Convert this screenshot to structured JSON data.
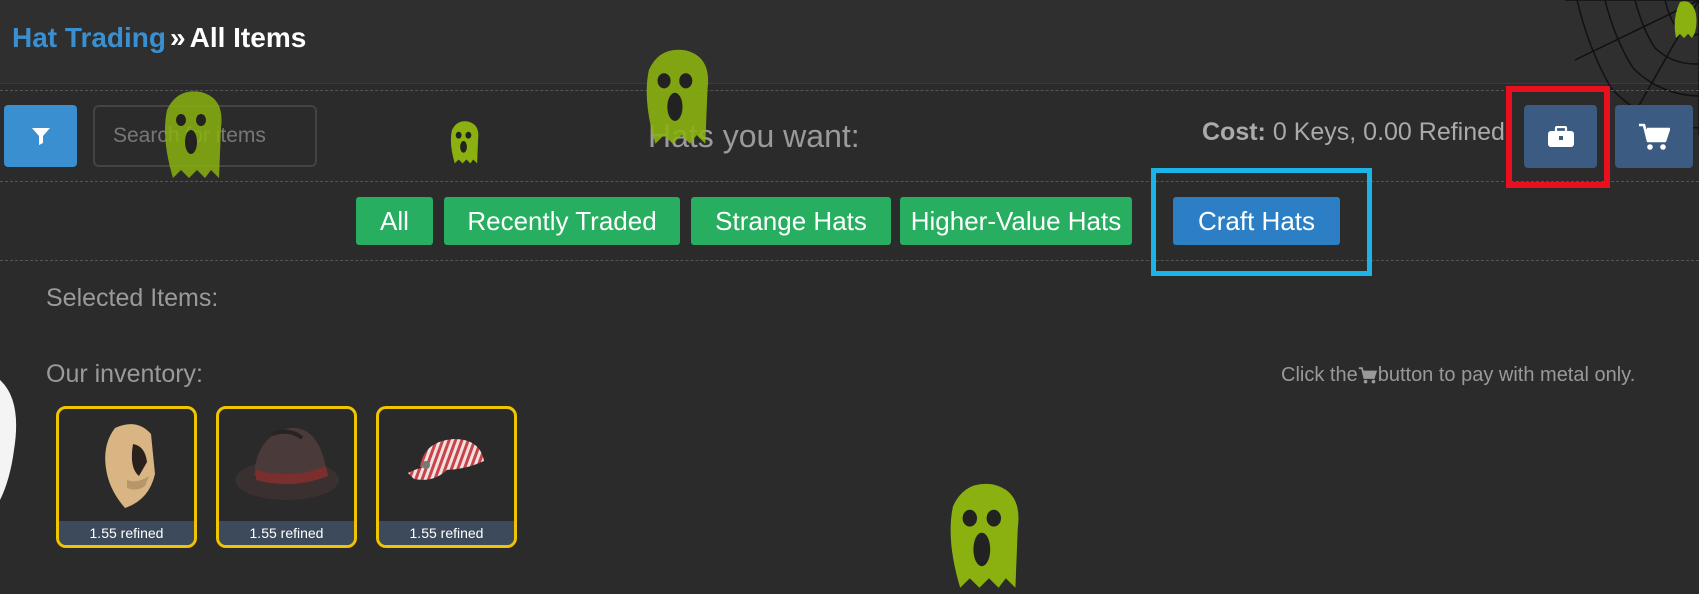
{
  "breadcrumb": {
    "link": "Hat Trading",
    "separator": "»",
    "current": "All Items"
  },
  "search": {
    "placeholder": "Search for items",
    "value": ""
  },
  "hats_title": "Hats you want:",
  "cost": {
    "label": "Cost:",
    "value": "0 Keys, 0.00 Refined"
  },
  "buttons": {
    "filter": "filter-icon",
    "briefcase": "briefcase-icon",
    "cart": "cart-icon"
  },
  "tabs": [
    {
      "label": "All",
      "active": false
    },
    {
      "label": "Recently Traded",
      "active": false
    },
    {
      "label": "Strange Hats",
      "active": false
    },
    {
      "label": "Higher-Value Hats",
      "active": false
    },
    {
      "label": "Craft Hats",
      "active": true
    }
  ],
  "selected_items_label": "Selected Items:",
  "inventory_label": "Our inventory:",
  "hint": {
    "before": "Click the",
    "after": "button to pay with metal only."
  },
  "items": [
    {
      "name": "hood hat",
      "price": "1.55 refined"
    },
    {
      "name": "brown fedora",
      "price": "1.55 refined"
    },
    {
      "name": "striped engineer cap",
      "price": "1.55 refined"
    }
  ],
  "colors": {
    "accent_blue": "#3a8fd0",
    "tab_green": "#27ae60",
    "tab_active": "#2c7fc4",
    "item_border": "#f0c400",
    "highlight_red": "#e8101e",
    "highlight_blue": "#1cb4e6"
  }
}
